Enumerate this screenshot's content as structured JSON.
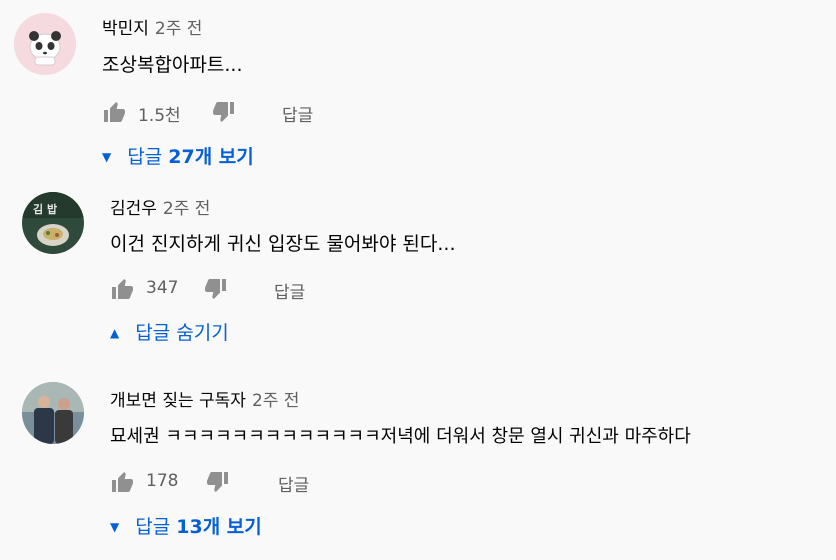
{
  "comments": [
    {
      "author": "박민지",
      "time": "2주 전",
      "text": "조상복합아파트...",
      "likes": "1.5천",
      "reply_label": "답글",
      "replies": {
        "prefix": "답글 ",
        "count": "27",
        "suffix": "개 보기",
        "expanded": false
      }
    },
    {
      "author": "김건우",
      "time": "2주 전",
      "text": "이건 진지하게 귀신 입장도 물어봐야 된다...",
      "likes": "347",
      "reply_label": "답글",
      "replies": {
        "label": "답글 숨기기",
        "expanded": true
      }
    },
    {
      "author": "개보면 짖는 구독자",
      "time": "2주 전",
      "text": "묘세권 ㅋㅋㅋㅋㅋㅋㅋㅋㅋㅋㅋㅋㅋ저녁에 더워서 창문 열시 귀신과 마주하다",
      "likes": "178",
      "reply_label": "답글",
      "replies": {
        "prefix": "답글 ",
        "count": "13",
        "suffix": "개 보기",
        "expanded": false
      }
    }
  ],
  "colors": {
    "link": "#065fd4",
    "meta": "#606060",
    "text": "#030303",
    "background": "#f9f9f9"
  }
}
